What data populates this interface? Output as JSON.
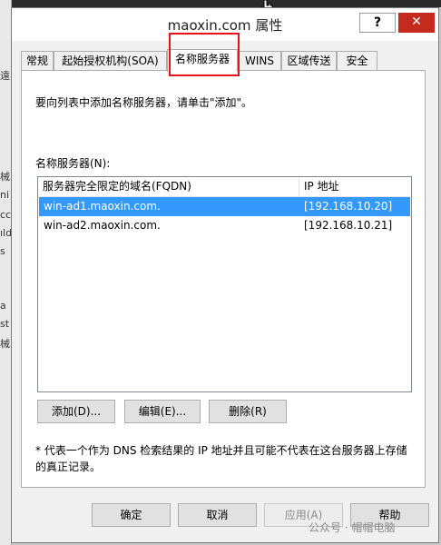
{
  "window": {
    "title": "maoxin.com 属性",
    "help_symbol": "?",
    "close_symbol": "✕"
  },
  "background_fragments": [
    "遠",
    "械",
    "ni",
    "cc",
    "ıld",
    "s",
    "a",
    "st",
    "械"
  ],
  "tabs": [
    {
      "label": "常规",
      "active": false
    },
    {
      "label": "起始授权机构(SOA)",
      "active": false
    },
    {
      "label": "名称服务器",
      "active": true
    },
    {
      "label": "WINS",
      "active": false
    },
    {
      "label": "区域传送",
      "active": false
    },
    {
      "label": "安全",
      "active": false
    }
  ],
  "panel": {
    "intro": "要向列表中添加名称服务器，请单击\"添加\"。",
    "list_label": "名称服务器(N):",
    "columns": {
      "fqdn": "服务器完全限定的域名(FQDN)",
      "ip": "IP 地址"
    },
    "rows": [
      {
        "fqdn": "win-ad1.maoxin.com.",
        "ip": "[192.168.10.20]",
        "selected": true
      },
      {
        "fqdn": "win-ad2.maoxin.com.",
        "ip": "[192.168.10.21]",
        "selected": false
      }
    ],
    "buttons": {
      "add": "添加(D)...",
      "edit": "编辑(E)...",
      "remove": "删除(R)"
    },
    "note": "* 代表一个作为 DNS 检索结果的 IP 地址并且可能不代表在这台服务器上存储的真正记录。"
  },
  "footer": {
    "ok": "确定",
    "cancel": "取消",
    "apply": "应用(A)",
    "help": "帮助"
  },
  "watermark": "公众号 · 帽帽电脑",
  "colors": {
    "selection": "#3399ff",
    "annotation": "#e8121b",
    "close": "#c42b1c"
  }
}
